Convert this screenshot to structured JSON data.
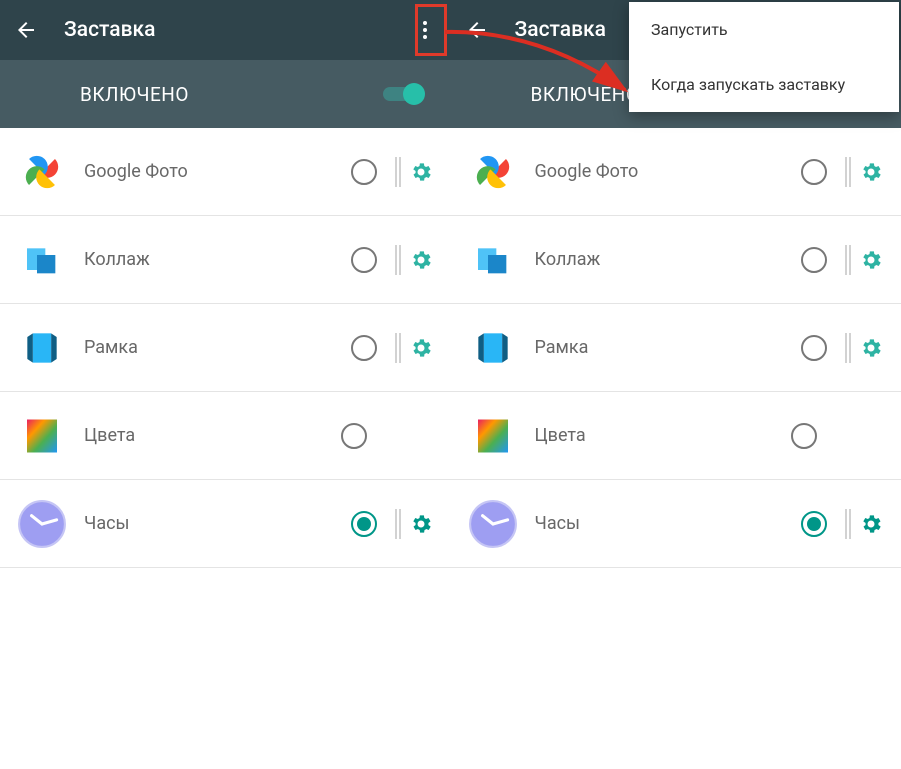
{
  "appbar": {
    "title": "Заставка"
  },
  "subheader": {
    "label": "ВКЛЮЧЕНО"
  },
  "items": [
    {
      "id": "google-photos",
      "label": "Google Фото",
      "selected": false,
      "has_settings": true
    },
    {
      "id": "collage",
      "label": "Коллаж",
      "selected": false,
      "has_settings": true
    },
    {
      "id": "frame",
      "label": "Рамка",
      "selected": false,
      "has_settings": true
    },
    {
      "id": "colors",
      "label": "Цвета",
      "selected": false,
      "has_settings": false
    },
    {
      "id": "clock",
      "label": "Часы",
      "selected": true,
      "has_settings": true
    }
  ],
  "popup": {
    "items": [
      {
        "label": "Запустить"
      },
      {
        "label": "Когда запускать заставку"
      }
    ]
  },
  "icons": {
    "back": "arrow-back",
    "overflow": "more-vert",
    "gear_teal": "#2eb3a3",
    "gear_sel": "#009688"
  }
}
